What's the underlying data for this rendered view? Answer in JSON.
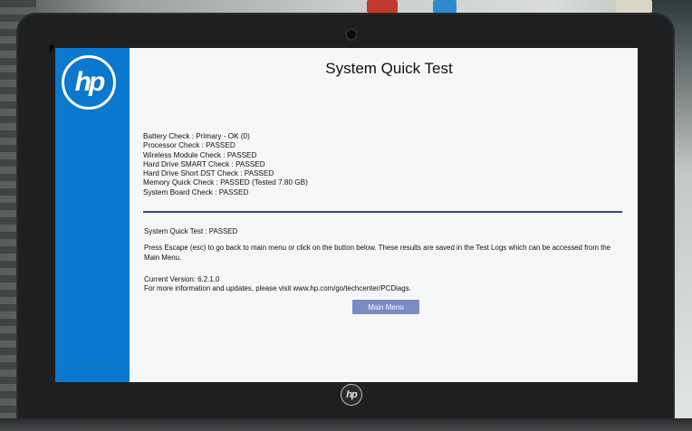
{
  "screen": {
    "title": "System Quick Test",
    "checks": [
      "Battery Check : Primary - OK (0)",
      "Processor Check : PASSED",
      "Wireless Module Check : PASSED",
      "Hard Drive SMART Check : PASSED",
      "Hard Drive Short DST Check : PASSED",
      "Memory Quick Check : PASSED (Tested 7.80 GB)",
      "System Board Check : PASSED"
    ],
    "summary": "System Quick Test : PASSED",
    "info": "Press Escape (esc) to go back to main menu or click on the button below. These results are saved in the Test Logs which can be accessed from the Main Menu.",
    "version": "Current Version: 6.2.1.0",
    "more_info": "For more information and updates, please visit www.hp.com/go/techcenter/PCDiags.",
    "main_menu_label": "Main Menu"
  },
  "colors": {
    "sidebar_blue": "#0b78d0",
    "divider": "#3c4676",
    "button": "#7a8cc2",
    "bezel": "#1e1f21"
  },
  "icons": {
    "sidebar_logo": "hp-logo-icon",
    "bezel_logo": "hp-logo-icon",
    "cursor": "mouse-pointer-icon"
  }
}
